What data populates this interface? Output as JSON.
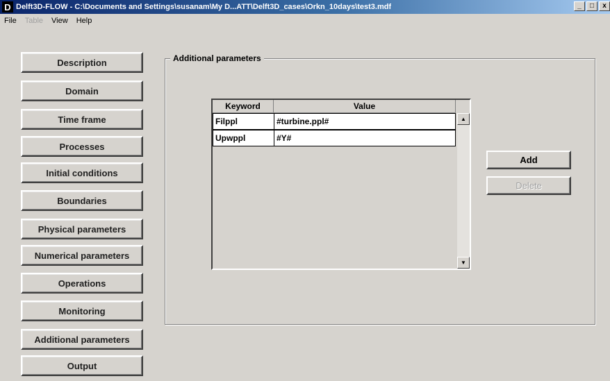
{
  "window": {
    "icon_letter": "D",
    "title": "Delft3D-FLOW - C:\\Documents and Settings\\susanam\\My D...ATT\\Delft3D_cases\\Orkn_10days\\test3.mdf",
    "controls": [
      "_",
      "□",
      "x"
    ]
  },
  "menubar": {
    "items": [
      {
        "label": "File",
        "enabled": true
      },
      {
        "label": "Table",
        "enabled": false
      },
      {
        "label": "View",
        "enabled": true
      },
      {
        "label": "Help",
        "enabled": true
      }
    ]
  },
  "sidebar": {
    "items": [
      {
        "label": "Description"
      },
      {
        "label": "Domain"
      },
      {
        "label": "Time frame"
      },
      {
        "label": "Processes"
      },
      {
        "label": "Initial conditions"
      },
      {
        "label": "Boundaries"
      },
      {
        "label": "Physical parameters"
      },
      {
        "label": "Numerical parameters"
      },
      {
        "label": "Operations"
      },
      {
        "label": "Monitoring"
      },
      {
        "label": "Additional parameters"
      },
      {
        "label": "Output"
      }
    ]
  },
  "panel": {
    "title": "Additional parameters",
    "table": {
      "columns": [
        "Keyword",
        "Value"
      ],
      "rows": [
        {
          "keyword": "Filppl",
          "value": "#turbine.ppl#"
        },
        {
          "keyword": "Upwppl",
          "value": "#Y#"
        }
      ]
    },
    "buttons": {
      "add": "Add",
      "delete": "Delete"
    }
  },
  "icons": {
    "scroll_up": "arrow-up-icon",
    "scroll_down": "arrow-down-icon"
  }
}
